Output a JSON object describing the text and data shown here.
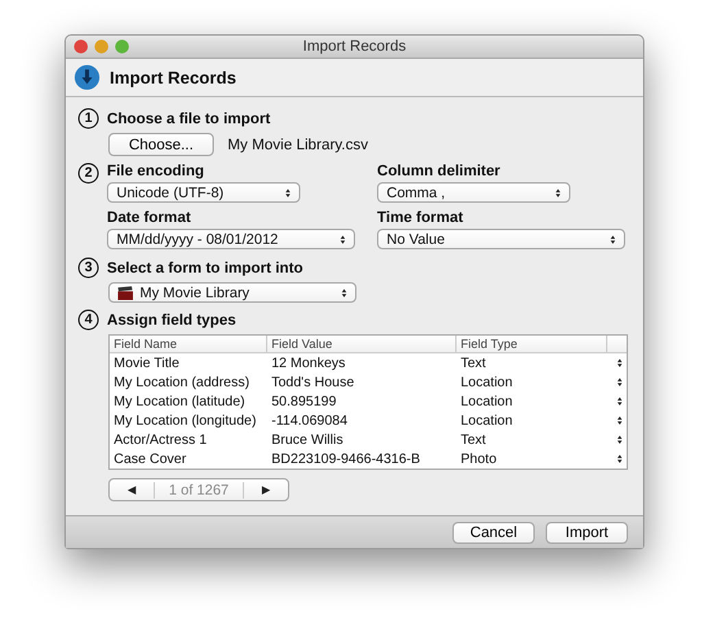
{
  "window": {
    "title": "Import Records"
  },
  "header": {
    "title": "Import Records"
  },
  "steps": [
    {
      "number": "1",
      "title": "Choose a file to import"
    },
    {
      "number": "2",
      "title": "File encoding"
    },
    {
      "number": "3",
      "title": "Select a form to import into"
    },
    {
      "number": "4",
      "title": "Assign field types"
    }
  ],
  "file": {
    "button": "Choose...",
    "filename": "My Movie Library.csv"
  },
  "encoding": {
    "value": "Unicode (UTF-8)"
  },
  "delimiter": {
    "label": "Column delimiter",
    "value": "Comma ,"
  },
  "date_format": {
    "label": "Date format",
    "value": "MM/dd/yyyy - 08/01/2012"
  },
  "time_format": {
    "label": "Time format",
    "value": "No Value"
  },
  "form": {
    "value": "My Movie Library"
  },
  "table": {
    "columns": [
      "Field Name",
      "Field Value",
      "Field Type"
    ],
    "rows": [
      [
        "Movie Title",
        "12 Monkeys",
        "Text"
      ],
      [
        "My Location (address)",
        "Todd's House",
        "Location"
      ],
      [
        "My Location (latitude)",
        "50.895199",
        "Location"
      ],
      [
        "My Location (longitude)",
        "-114.069084",
        "Location"
      ],
      [
        "Actor/Actress 1",
        "Bruce Willis",
        "Text"
      ],
      [
        "Case Cover",
        "BD223109-9466-4316-B",
        "Photo"
      ]
    ]
  },
  "pager": {
    "prev": "◀",
    "label": "1 of 1267",
    "next": "▶"
  },
  "buttons": [
    "Cancel",
    "Import"
  ]
}
